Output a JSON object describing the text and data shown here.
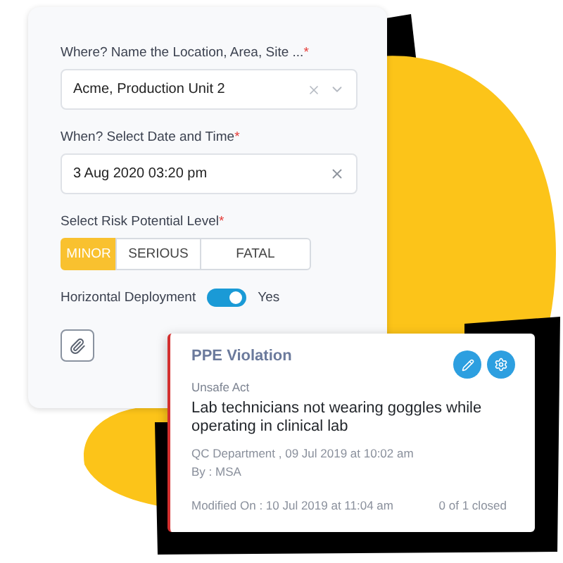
{
  "form": {
    "location": {
      "label": "Where? Name the Location, Area, Site ...",
      "required_mark": "*",
      "value": "Acme, Production Unit 2"
    },
    "datetime": {
      "label": "When? Select Date and Time",
      "required_mark": "*",
      "value": "3 Aug 2020 03:20 pm"
    },
    "risk": {
      "label": "Select Risk Potential Level",
      "required_mark": "*",
      "options": [
        {
          "label": "MINOR",
          "selected": true
        },
        {
          "label": "SERIOUS",
          "selected": false
        },
        {
          "label": "FATAL",
          "selected": false
        }
      ]
    },
    "deployment": {
      "label": "Horizontal Deployment",
      "on": true,
      "state_text": "Yes"
    }
  },
  "card": {
    "title": "PPE Violation",
    "category": "Unsafe Act",
    "description": "Lab technicians not wearing goggles while operating in clinical lab",
    "department_date": "QC Department , 09 Jul 2019 at 10:02 am",
    "by": "By : MSA",
    "modified": "Modified On : 10 Jul 2019 at 11:04 am",
    "closed_count": "0 of 1 closed"
  }
}
